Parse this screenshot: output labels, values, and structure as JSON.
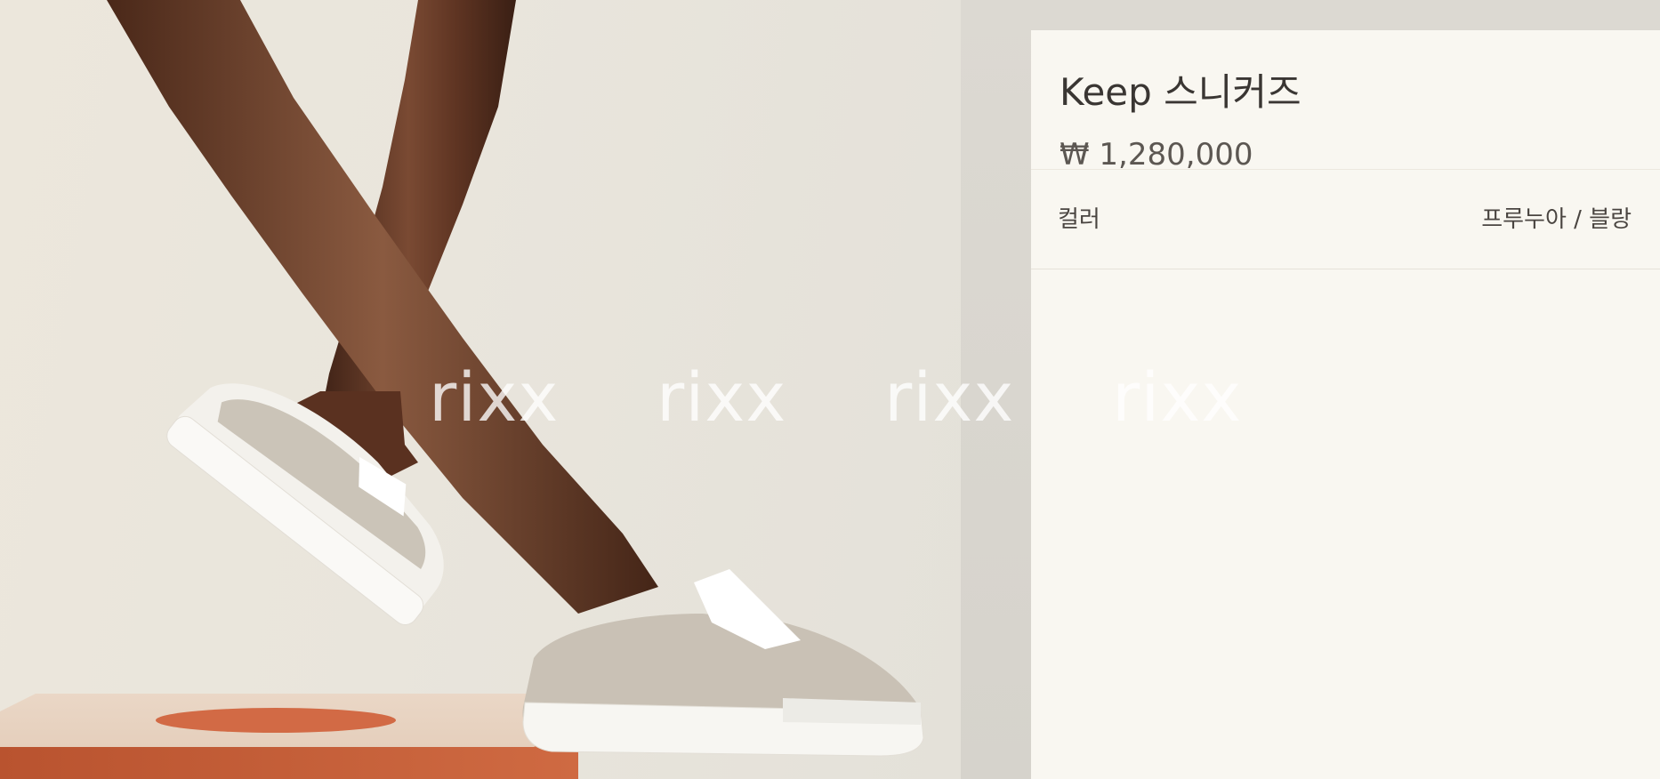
{
  "product": {
    "title": "Keep 스니커즈",
    "price": "₩ 1,280,000",
    "color_label": "컬러",
    "color_value": "프루누아 / 블랑"
  },
  "watermark": {
    "text": [
      "rixx",
      "rixx",
      "rixx",
      "rixx"
    ]
  },
  "colors": {
    "panel_bg": "#f9f7f1",
    "image_bg": "#ece7dc",
    "pedestal": "#c85e3a",
    "shoe": "#f4f2ee",
    "canvas_upper": "#c8c0b4",
    "skin": "#5a3322"
  }
}
